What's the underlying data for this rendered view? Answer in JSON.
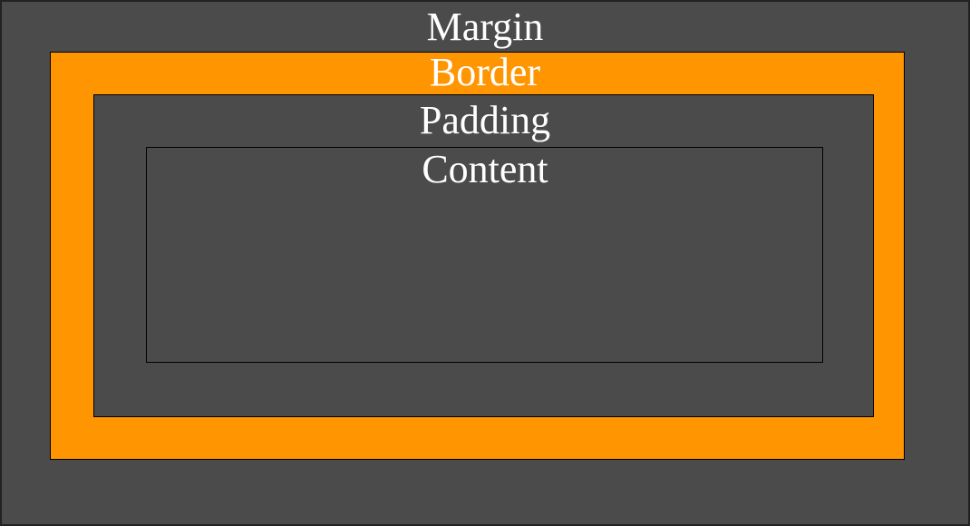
{
  "diagram": {
    "layers": [
      {
        "label": "Margin",
        "color": "#4b4b4b"
      },
      {
        "label": "Border",
        "color": "#ff9500"
      },
      {
        "label": "Padding",
        "color": "#4b4b4b"
      },
      {
        "label": "Content",
        "color": "#4b4b4b"
      }
    ]
  }
}
